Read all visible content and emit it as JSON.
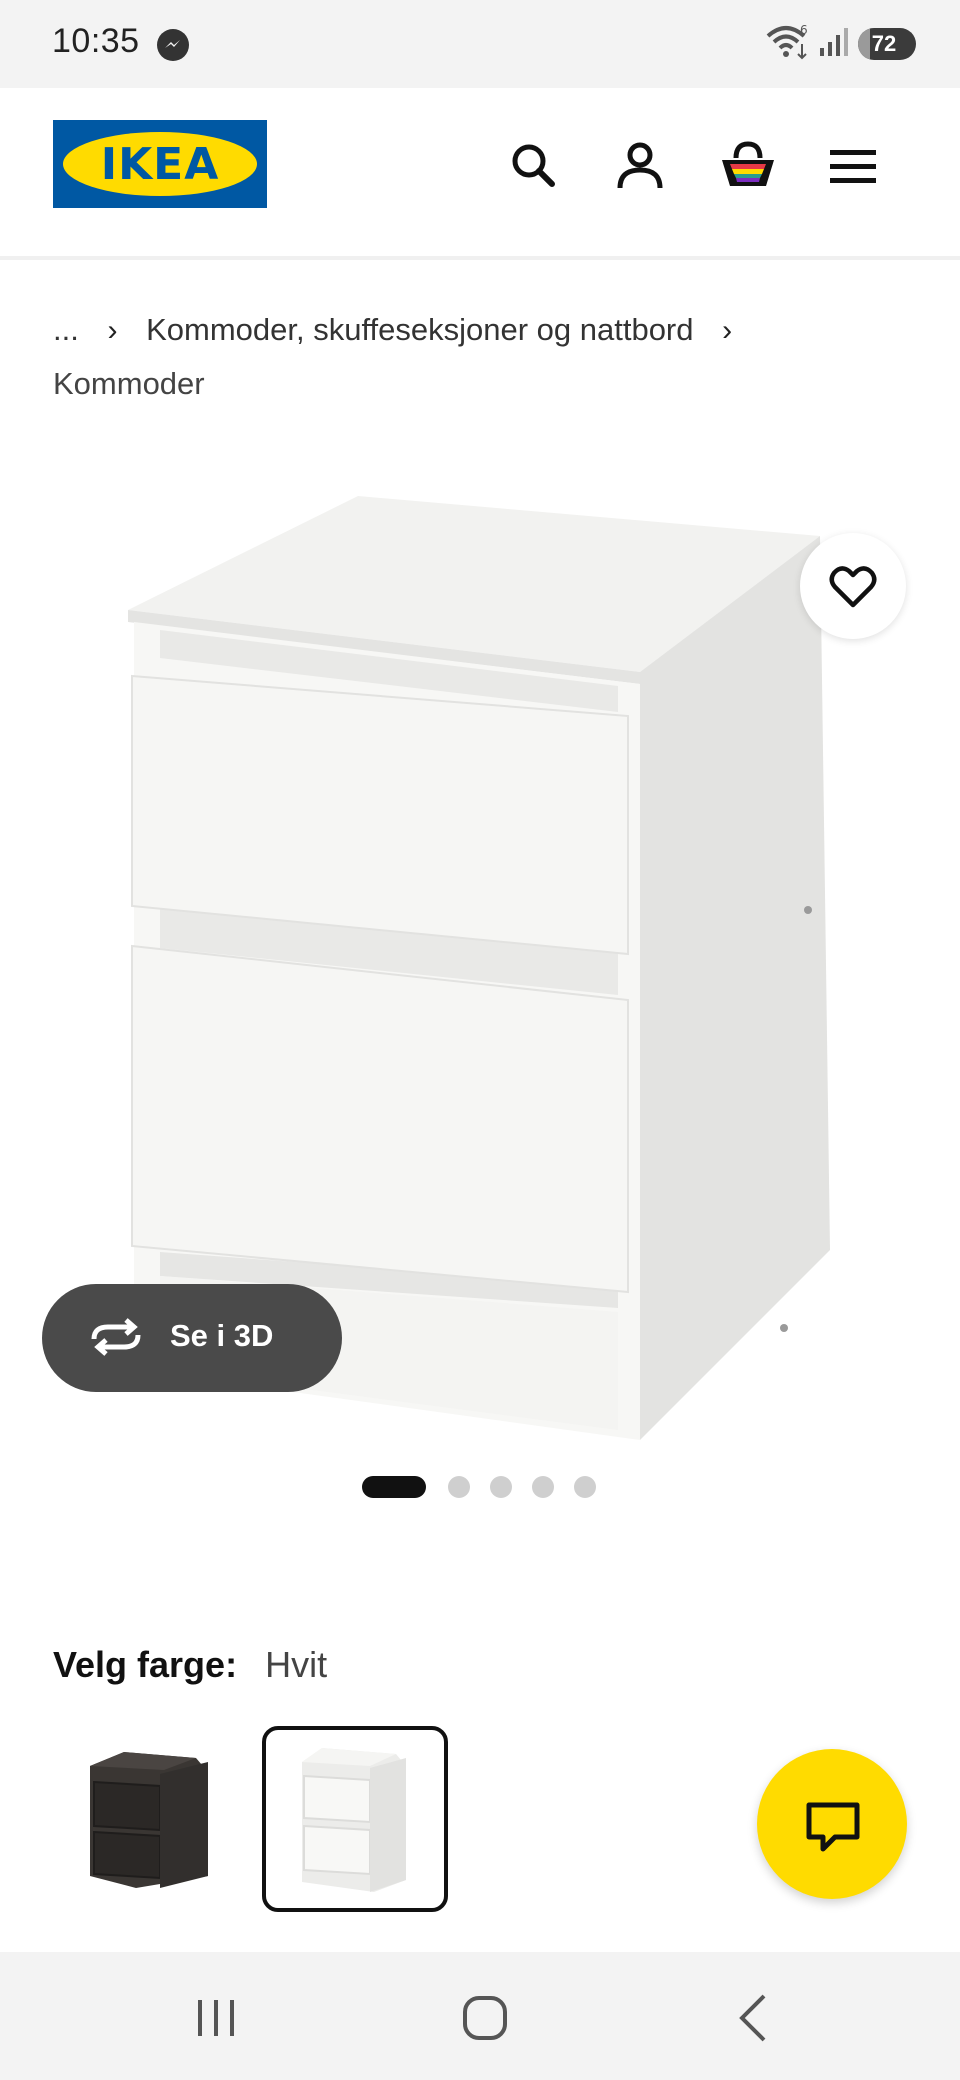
{
  "status_bar": {
    "time": "10:35",
    "wifi_badge": "6",
    "battery": "72",
    "icons": [
      "messenger-icon",
      "wifi-icon",
      "signal-icon",
      "battery-icon"
    ]
  },
  "header": {
    "logo_text": "IKEA",
    "icons": [
      "search-icon",
      "account-icon",
      "cart-icon",
      "menu-icon"
    ]
  },
  "breadcrumb": {
    "ellipsis": "...",
    "parent": "Kommoder, skuffeseksjoner og nattbord",
    "current": "Kommoder"
  },
  "product": {
    "view_3d_label": "Se i 3D",
    "image_count": 5,
    "active_image": 1
  },
  "color_selector": {
    "label": "Velg farge:",
    "selected_value": "Hvit",
    "options": [
      "black-brown",
      "white"
    ],
    "selected_index": 1
  },
  "colors": {
    "ikea_blue": "#0058a3",
    "ikea_yellow": "#ffdb00"
  }
}
